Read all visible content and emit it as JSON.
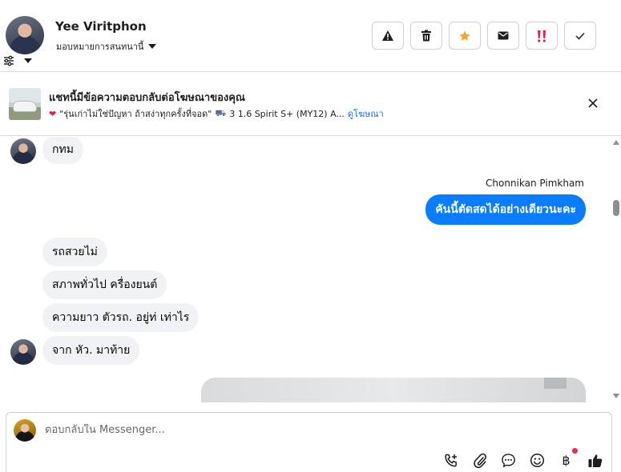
{
  "header": {
    "name": "Yee Viritphon",
    "assign_label": "มอบหมายการสนทนานี้",
    "actions": [
      {
        "name": "spam-button",
        "icon": "warning-icon"
      },
      {
        "name": "delete-button",
        "icon": "trash-icon"
      },
      {
        "name": "star-button",
        "icon": "star-icon"
      },
      {
        "name": "mark-unread-button",
        "icon": "envelope-icon"
      },
      {
        "name": "follow-up-button",
        "icon": "double-exclamation-icon"
      },
      {
        "name": "mark-done-button",
        "icon": "check-icon"
      }
    ]
  },
  "banner": {
    "title": "แชทนี้มีข้อความตอบกลับต่อโฆษณาของคุณ",
    "ad_text": "\"รุ่นเก่าไม่ใช่ปัญหา ถ้าสง่าทุกครั้งที่จอด\"",
    "car_text": "3 1.6 Spirit S+ (MY12) A...",
    "view_ad_link": "ดูโฆษณา"
  },
  "messages": {
    "first_incoming": "กทม",
    "sender_name": "Chonnikan Pimkham",
    "outgoing": "คันนี้ตัดสดได้อย่างเดียวนะคะ",
    "incoming_group": [
      "รถสวยไม่",
      "สภาพทั่วไป ครื่องยนต์",
      "ความยาว ตัวรถ. อยู่ท่ เท่าไร",
      "จาก หัว. มาท้าย"
    ]
  },
  "composer": {
    "placeholder": "ตอบกลับใน Messenger...",
    "tools": [
      "call-add-icon",
      "paperclip-icon",
      "saved-reply-icon",
      "emoji-icon",
      "baht-icon",
      "thumbs-up-icon"
    ],
    "baht_symbol": "฿"
  },
  "colors": {
    "outgoing_bubble": "#0a7cff",
    "incoming_bubble": "#f0f2f5",
    "star": "#f5a623",
    "urgent": "#e41e3f",
    "link": "#1a73e8"
  }
}
